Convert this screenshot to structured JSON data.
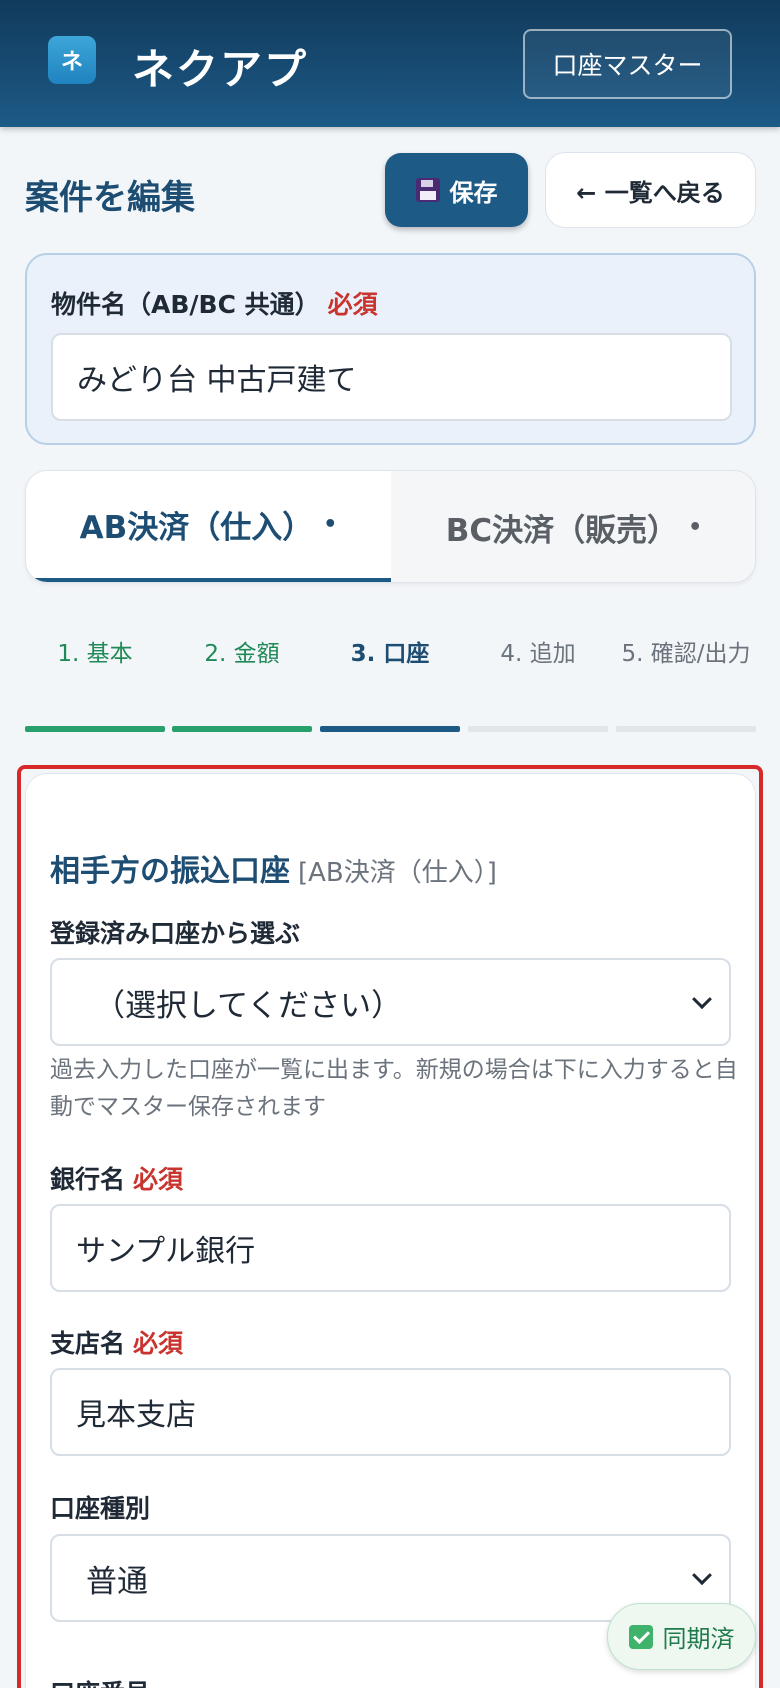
{
  "header": {
    "logo_glyph": "ネ",
    "app_title": "ネクアプ",
    "master_button": "口座マスター"
  },
  "page": {
    "title": "案件を編集",
    "save_label": "保存",
    "back_label": "← 一覧へ戻る"
  },
  "property": {
    "label": "物件名（AB/BC 共通）",
    "required": "必須",
    "value": "みどり台 中古戸建て"
  },
  "tabs": [
    {
      "label": "AB決済（仕入）",
      "dot": "•"
    },
    {
      "label": "BC決済（販売）",
      "dot": "•"
    }
  ],
  "steps": [
    {
      "label": "1. 基本",
      "state": "done"
    },
    {
      "label": "2. 金額",
      "state": "done"
    },
    {
      "label": "3. 口座",
      "state": "active"
    },
    {
      "label": "4. 追加",
      "state": "todo"
    },
    {
      "label": "5. 確認/出力",
      "state": "todo"
    }
  ],
  "account": {
    "section_title": "相手方の振込口座",
    "section_sub": "[AB決済（仕入）]",
    "saved_label": "登録済み口座から選ぶ",
    "saved_value": "（選択してください）",
    "hint": "過去入力した口座が一覧に出ます。新規の場合は下に入力すると自動でマスター保存されます",
    "bank_label": "銀行名",
    "bank_required": "必須",
    "bank_value": "サンプル銀行",
    "branch_label": "支店名",
    "branch_required": "必須",
    "branch_value": "見本支店",
    "type_label": "口座種別",
    "type_value": "普通",
    "number_label": "口座番号"
  },
  "status": {
    "sync_label": "同期済"
  },
  "colors": {
    "header": "#1d5a86",
    "primary": "#1d4d72",
    "required": "#c9342f",
    "step_done": "#27a06b",
    "highlight_outline": "#d62a2a"
  }
}
